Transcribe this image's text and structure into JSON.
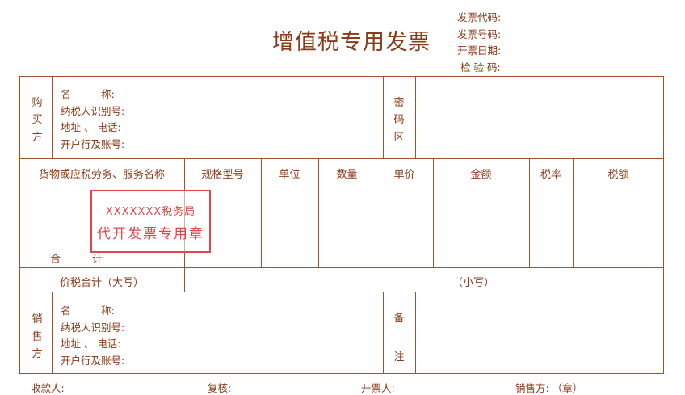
{
  "header": {
    "title": "增值税专用发票",
    "invoice_code_label": "发票代码:",
    "invoice_number_label": "发票号码:",
    "issue_date_label": "开票日期:",
    "check_code_label": "检 验 码:"
  },
  "buyer": {
    "side_label": [
      "购",
      "买",
      "方"
    ],
    "name_label": "名　　　称:",
    "tax_id_label": "纳税人识别号:",
    "address_label": "地址 、 电话:",
    "bank_label": "开户行及账号:"
  },
  "cipher": {
    "side_label": [
      "密",
      "码",
      "区"
    ]
  },
  "items": {
    "columns": [
      "货物或应税劳务、服务名称",
      "规格型号",
      "单位",
      "数量",
      "单价",
      "金额",
      "税率",
      "税额"
    ],
    "total_label": "合　　　计"
  },
  "totals": {
    "uppercase_label": "价税合计（大写）",
    "lowercase_label": "（小写）"
  },
  "seller": {
    "side_label": [
      "销",
      "售",
      "方"
    ],
    "name_label": "名　　　称:",
    "tax_id_label": "纳税人识别号:",
    "address_label": "地址 、 电话:",
    "bank_label": "开户行及账号:"
  },
  "remarks": {
    "side_label": [
      "备",
      "注"
    ]
  },
  "stamp": {
    "line1": "XXXXXXX税务局",
    "line2": "代开发票专用章",
    "color": "#e0474a"
  },
  "footer": {
    "payee_label": "收款人:",
    "reviewer_label": "复核:",
    "drawer_label": "开票人:",
    "seller_label": "销售方: （章）"
  },
  "colors": {
    "ink": "#8b3a1a",
    "line": "#a0522d"
  }
}
